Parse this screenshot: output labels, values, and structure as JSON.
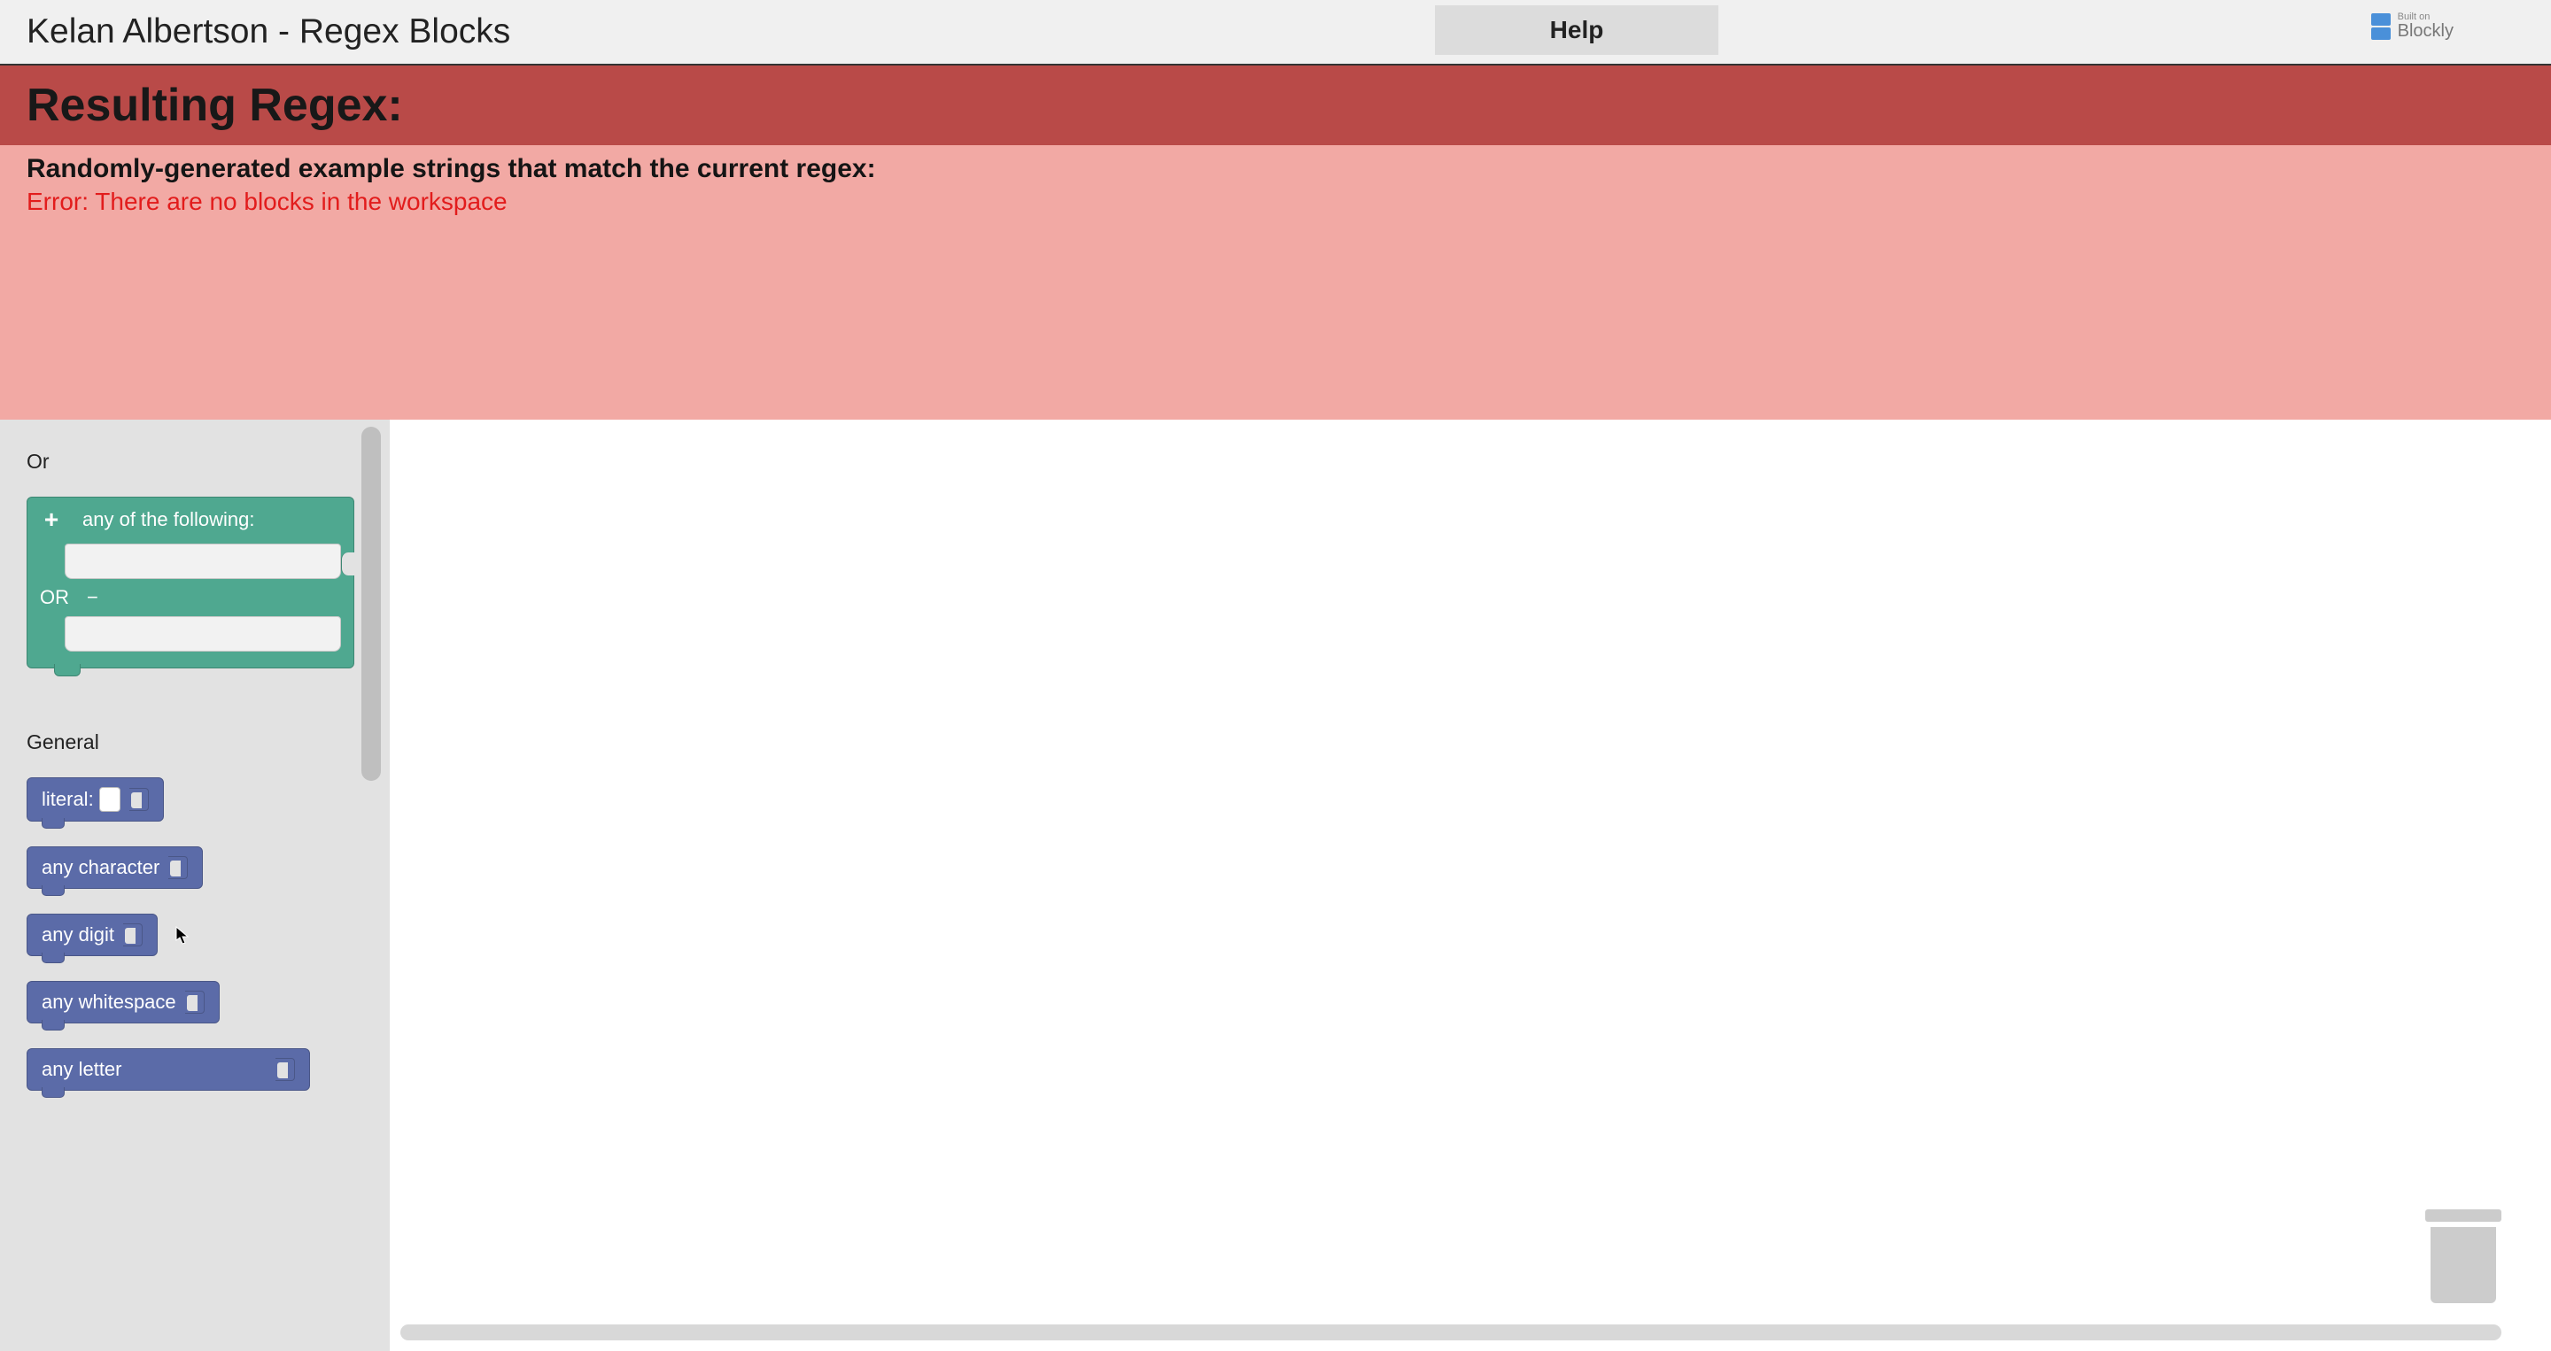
{
  "header": {
    "title": "Kelan Albertson - Regex Blocks",
    "help_button": "Help",
    "logo": {
      "built_on": "Built on",
      "name": "Blockly"
    }
  },
  "result": {
    "heading": "Resulting Regex:"
  },
  "examples": {
    "label": "Randomly-generated example strings that match the current regex:",
    "error": "Error: There are no blocks in the workspace"
  },
  "toolbox": {
    "categories": {
      "or": {
        "label": "Or",
        "block": {
          "plus": "+",
          "header_text": "any of the following:",
          "or_text": "OR",
          "minus": "−"
        }
      },
      "general": {
        "label": "General",
        "blocks": {
          "literal": "literal:",
          "any_character": "any character",
          "any_digit": "any digit",
          "any_whitespace": "any whitespace",
          "any_letter": "any letter"
        }
      }
    }
  },
  "icons": {
    "trash": "trash-icon",
    "blockly": "blockly-logo-icon"
  },
  "colors": {
    "or_block": "#4fa890",
    "gen_block": "#5b6ba8",
    "result_bar": "#b94a48",
    "examples_panel": "#f2a9a4",
    "error_text": "#e21c1c"
  }
}
